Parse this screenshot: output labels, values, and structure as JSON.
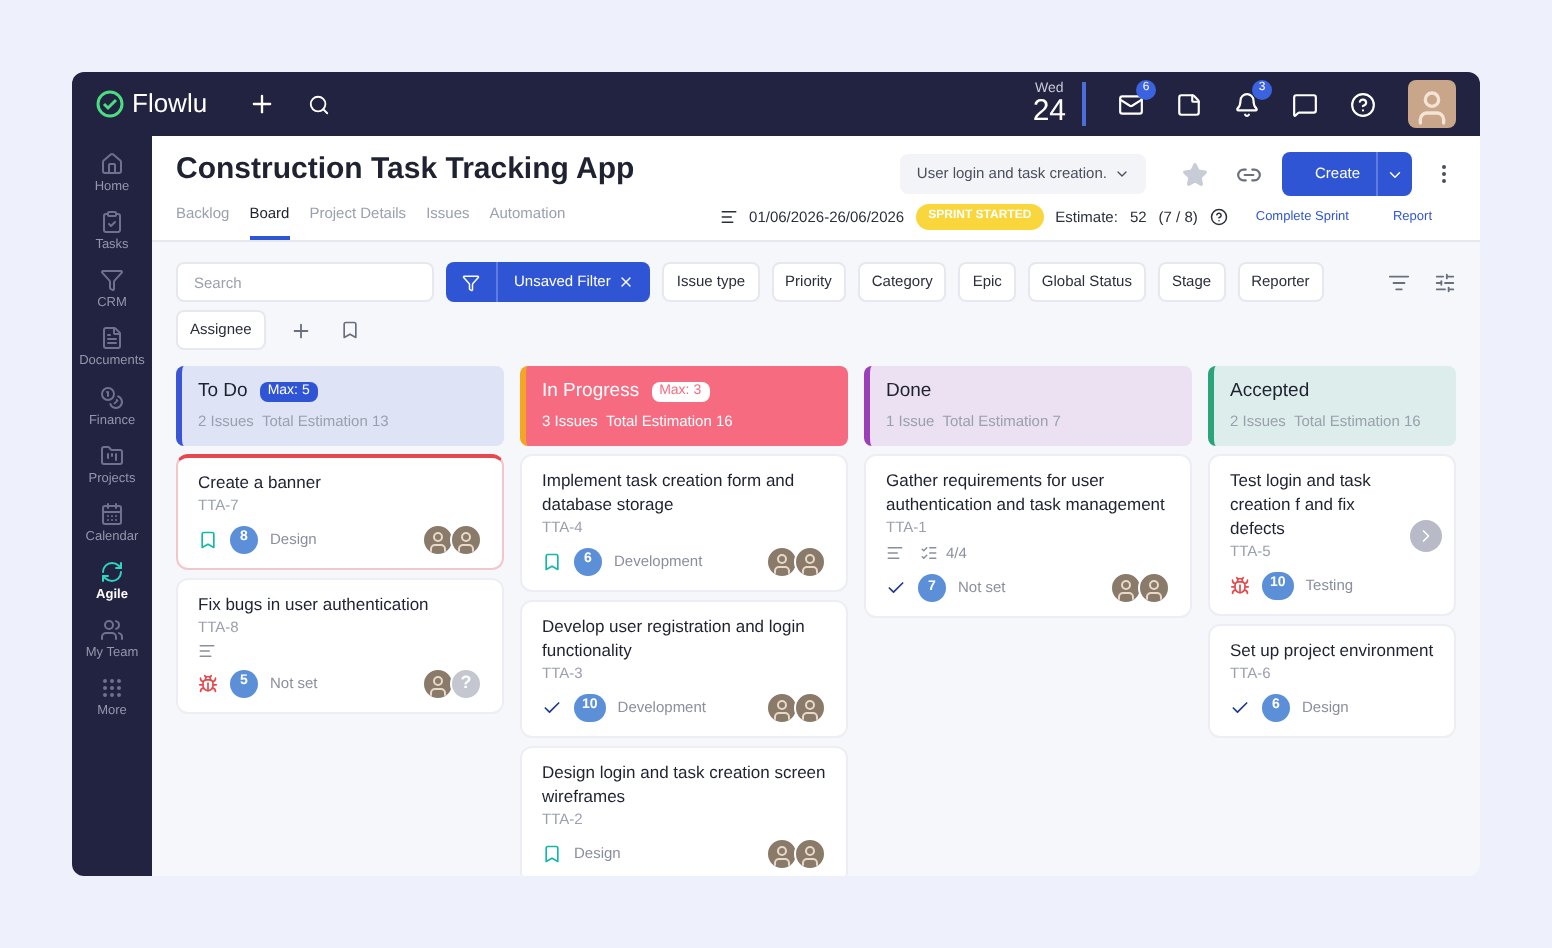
{
  "topbar": {
    "logo": "Flowlu",
    "date": {
      "weekday": "Wed",
      "day": "24"
    },
    "icons": [
      {
        "kind": "mail",
        "badge": "6"
      },
      {
        "kind": "notes"
      },
      {
        "kind": "bell",
        "badge": "3"
      },
      {
        "kind": "chat"
      },
      {
        "kind": "help"
      }
    ]
  },
  "sidebar": {
    "items": [
      {
        "label": "Home",
        "kind": "home",
        "selected": false
      },
      {
        "label": "Tasks",
        "kind": "tasks",
        "selected": false
      },
      {
        "label": "CRM",
        "kind": "crm",
        "selected": false
      },
      {
        "label": "Documents",
        "kind": "documents",
        "selected": false
      },
      {
        "label": "Finance",
        "kind": "finance",
        "selected": false
      },
      {
        "label": "Projects",
        "kind": "projects",
        "selected": false
      },
      {
        "label": "Calendar",
        "kind": "calendar",
        "selected": false
      },
      {
        "label": "Agile",
        "kind": "agile",
        "selected": true
      },
      {
        "label": "My Team",
        "kind": "team",
        "selected": false
      },
      {
        "label": "More",
        "kind": "more",
        "selected": false
      }
    ]
  },
  "header": {
    "title": "Construction Task Tracking App",
    "tabs": [
      {
        "label": "Backlog",
        "selected": false
      },
      {
        "label": "Board",
        "selected": true
      },
      {
        "label": "Project Details",
        "selected": false
      },
      {
        "label": "Issues",
        "selected": false
      },
      {
        "label": "Automation",
        "selected": false
      }
    ],
    "sprint_select": "User login and task creation.",
    "dates": "01/06/2026-26/06/2026",
    "sprint_status": "SPRINT STARTED",
    "estimate_label": "Estimate:",
    "estimate_value": "52",
    "estimate_count": "(7 / 8)",
    "complete_sprint": "Complete Sprint",
    "report": "Report",
    "create": "Create"
  },
  "filters": {
    "search_placeholder": "Search",
    "active_filter": "Unsaved Filter",
    "chips": [
      "Issue type",
      "Priority",
      "Category",
      "Epic",
      "Global Status",
      "Stage",
      "Reporter",
      "Assignee"
    ]
  },
  "columns": [
    {
      "name": "To Do",
      "max": "Max: 5",
      "issues": "2 Issues",
      "estimation": "Total Estimation 13",
      "color": "#3a56d4",
      "filled": false,
      "cards": [
        {
          "title": "Create a banner",
          "key": "TTA-7",
          "kind": "story",
          "points": "8",
          "category": "Design",
          "highlighted": true,
          "description": false,
          "assignees": [
            {
              "kind": "photo"
            },
            {
              "kind": "photo"
            }
          ]
        },
        {
          "title": "Fix bugs in user authentication",
          "key": "TTA-8",
          "kind": "bug",
          "points": "5",
          "category": "Not set",
          "highlighted": false,
          "description": true,
          "assignees": [
            {
              "kind": "photo"
            },
            {
              "kind": "unknown",
              "label": "?"
            }
          ]
        }
      ]
    },
    {
      "name": "In Progress",
      "max": "Max: 3",
      "issues": "3 Issues",
      "estimation": "Total Estimation 16",
      "color": "#f5a524",
      "filled": true,
      "cards": [
        {
          "title": "Implement task creation form and database storage",
          "key": "TTA-4",
          "kind": "story",
          "points": "6",
          "category": "Development",
          "highlighted": false,
          "description": false,
          "assignees": [
            {
              "kind": "photo"
            },
            {
              "kind": "photo"
            }
          ]
        },
        {
          "title": "Develop user registration and login functionality",
          "key": "TTA-3",
          "kind": "task",
          "points": "10",
          "category": "Development",
          "highlighted": false,
          "description": false,
          "assignees": [
            {
              "kind": "photo"
            },
            {
              "kind": "photo"
            }
          ]
        },
        {
          "title": "Design login and task creation screen wireframes",
          "key": "TTA-2",
          "kind": "story",
          "category": "Design",
          "highlighted": false,
          "description": false,
          "assignees": [
            {
              "kind": "photo"
            },
            {
              "kind": "photo"
            }
          ]
        }
      ]
    },
    {
      "name": "Done",
      "issues": "1 Issue",
      "estimation": "Total Estimation 7",
      "color": "#9b3fb8",
      "filled": false,
      "cards": [
        {
          "title": "Gather requirements for user authentication and task management",
          "key": "TTA-1",
          "kind": "task",
          "points": "7",
          "category": "Not set",
          "highlighted": false,
          "description": true,
          "checklist": "4/4",
          "assignees": [
            {
              "kind": "photo"
            },
            {
              "kind": "photo"
            }
          ]
        }
      ]
    },
    {
      "name": "Accepted",
      "issues": "2 Issues",
      "estimation": "Total Estimation 16",
      "color": "#2aa57a",
      "filled": false,
      "cards": [
        {
          "title": "Test login and task creation f and fix defects",
          "key": "TTA-5",
          "kind": "bug",
          "points": "10",
          "category": "Testing",
          "highlighted": false,
          "description": false,
          "next": true
        },
        {
          "title": "Set up project environment",
          "key": "TTA-6",
          "kind": "task",
          "points": "6",
          "category": "Design",
          "highlighted": false,
          "description": false
        }
      ]
    }
  ]
}
